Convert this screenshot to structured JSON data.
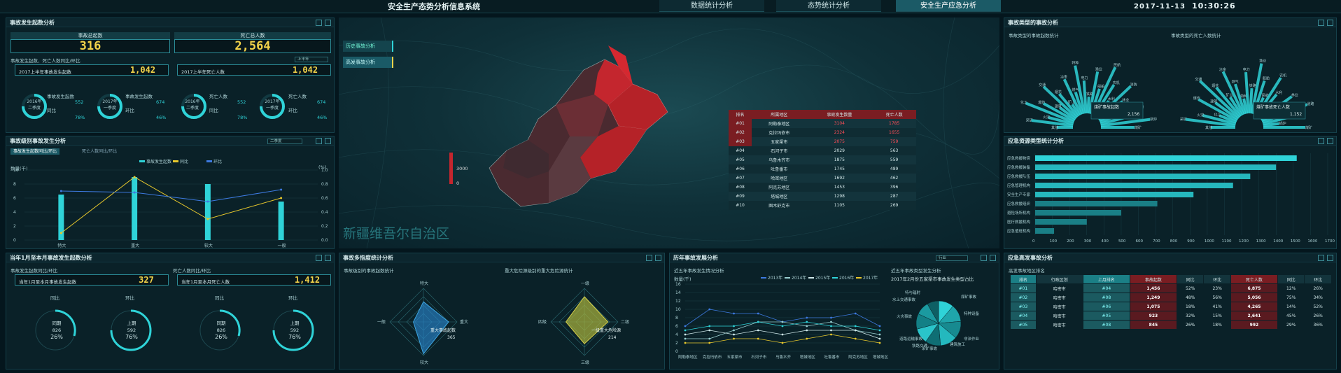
{
  "header": {
    "title": "安全生产态势分析信息系统",
    "nav": [
      "数据统计分析",
      "态势统计分析",
      "安全生产应急分析"
    ],
    "active": 2,
    "date": "2017-11-13",
    "time": "10:30:26"
  },
  "p1": {
    "title": "事故发生起数分析",
    "total_label": "事故总起数",
    "total": "316",
    "death_label": "死亡总人数",
    "death": "2,564",
    "sub": "事故发生起数、死亡人数同比/环比",
    "sel": "上半年",
    "left": {
      "label": "2017上半年事故发生起数",
      "value": "1,042",
      "g1": {
        "q": "2016年",
        "q2": "二季度",
        "a": "事故发生起数",
        "av": "552",
        "b": "同比",
        "bv": "78%"
      },
      "g2": {
        "q": "2017年",
        "q2": "一季度",
        "a": "事故发生起数",
        "av": "674",
        "b": "环比",
        "bv": "46%"
      }
    },
    "right": {
      "label": "2017上半年死亡人数",
      "value": "1,042",
      "g1": {
        "q": "2016年",
        "q2": "二季度",
        "a": "死亡人数",
        "av": "552",
        "b": "同比",
        "bv": "78%"
      },
      "g2": {
        "q": "2017年",
        "q2": "一季度",
        "a": "死亡人数",
        "av": "674",
        "b": "环比",
        "bv": "46%"
      }
    }
  },
  "p2": {
    "title": "事故级别事故发生分析",
    "sel": "二季度",
    "tabs": [
      "事故发生起数同比/环比",
      "死亡人数同比/环比"
    ],
    "legend": [
      "事故发生起数",
      "同比",
      "环比"
    ],
    "yl": "数量(千)",
    "yr": "(%)"
  },
  "p3": {
    "title": "当年1月至本月事故发生起数分析",
    "left": {
      "sub": "事故发生起数同比/环比",
      "label": "当年1月至本月事故发生起数",
      "value": "327"
    },
    "right": {
      "sub": "死亡人数同比/环比",
      "label": "当年1月至本月死亡人数",
      "value": "1,412"
    },
    "g": [
      {
        "h": "同比",
        "t": "同期",
        "v": "826",
        "p": "26%"
      },
      {
        "h": "环比",
        "t": "上期",
        "v": "592",
        "p": "76%"
      },
      {
        "h": "同比",
        "t": "同期",
        "v": "826",
        "p": "26%"
      },
      {
        "h": "环比",
        "t": "上期",
        "v": "592",
        "p": "76%"
      }
    ]
  },
  "map": {
    "tabs": [
      "历史事故分析",
      "高发事故分析"
    ],
    "region": "新疆维吾尔自治区",
    "scale_hi": "3000",
    "scale_lo": "0",
    "places": [
      "阿勒泰地区",
      "塔城地区",
      "克拉玛依市",
      "博尔塔拉蒙古自治州",
      "伊犁哈萨克自治州",
      "石河子市",
      "五家渠市",
      "昌吉回族自治州",
      "乌鲁木齐市",
      "吐鲁番市",
      "哈密地区",
      "阿克苏地区",
      "巴音郭楞蒙古自治州",
      "克孜勒苏柯尔克孜自治州",
      "喀什地区",
      "和田地区",
      "图木舒克市",
      "阿拉尔市"
    ],
    "table": {
      "headers": [
        "排名",
        "所属地区",
        "事故发生数量",
        "死亡人数"
      ],
      "rows": [
        [
          "#01",
          "阿勒泰地区",
          "3104",
          "1785"
        ],
        [
          "#02",
          "克拉玛依市",
          "2324",
          "1655"
        ],
        [
          "#03",
          "五家渠市",
          "2075",
          "759"
        ],
        [
          "#04",
          "石河子市",
          "2029",
          "563"
        ],
        [
          "#05",
          "乌鲁木齐市",
          "1875",
          "559"
        ],
        [
          "#06",
          "吐鲁番市",
          "1745",
          "489"
        ],
        [
          "#07",
          "哈密地区",
          "1692",
          "462"
        ],
        [
          "#08",
          "阿克苏地区",
          "1453",
          "396"
        ],
        [
          "#09",
          "塔城地区",
          "1298",
          "287"
        ],
        [
          "#10",
          "图木舒克市",
          "1105",
          "269"
        ]
      ]
    }
  },
  "p4": {
    "title": "事故多指度统计分析",
    "l": {
      "sub": "事故级别的事故起数统计",
      "axes": [
        "特大",
        "重大",
        "较大",
        "一般"
      ],
      "label": "重大事故起数",
      "val": "365"
    },
    "r": {
      "sub": "重大危险源级别的重大危险源统计",
      "axes": [
        "一级",
        "二级",
        "三级",
        "四级"
      ],
      "label": "一级重大危险源",
      "val": "214"
    }
  },
  "p5": {
    "title": "历年事故发展分析",
    "sel": "行业",
    "l": {
      "sub": "近五年事故发生情况分析",
      "yl": "数量(千)",
      "legend": [
        "2013年",
        "2014年",
        "2015年",
        "2016年",
        "2017年"
      ],
      "x": [
        "阿勒泰地区",
        "克拉玛依市",
        "五家渠市",
        "石河子市",
        "乌鲁木齐",
        "塔城地区",
        "吐鲁番市",
        "阿克苏地区",
        "塔城地区"
      ]
    },
    "r": {
      "sub": "近五年事故类型发生分析",
      "sub2": "2017年2月份五家渠市事故发生类型占比",
      "labels": [
        "特与辐射",
        "水上交通事故",
        "煤矿事故",
        "火灾事故",
        "特种设备",
        "道路运输事故",
        "非法作业",
        "铁路交通",
        "建筑施工",
        "采矿事故"
      ]
    }
  },
  "p6": {
    "title": "事故类型的事故分析",
    "l": {
      "sub": "事故类型的事故起数统计",
      "tip": "煤矿事故起数",
      "tipv": "2,156"
    },
    "r": {
      "sub": "事故类型的死亡人数统计",
      "tip": "煤矿事故死亡人数",
      "tipv": "1,152"
    },
    "cats": [
      "其他",
      "采矿",
      "火灾",
      "化工",
      "爆炸",
      "建筑",
      "交通",
      "烟花",
      "矿山",
      "冶金",
      "燃气",
      "特种",
      "电力",
      "铁路",
      "渔业",
      "船舶",
      "民航",
      "农机",
      "水利",
      "消防",
      "林业",
      "危化",
      "道路",
      "机械",
      "锅炉",
      "煤矿"
    ]
  },
  "p7": {
    "title": "应急资源类型统计分析",
    "items": [
      "应急救援物资",
      "应急救援装备",
      "应急救援队伍",
      "应急管理机构",
      "安全生产专家",
      "应急救援组织",
      "避险场所机构",
      "医疗救援机构",
      "应急值班机构"
    ],
    "values": [
      1520,
      1400,
      1250,
      1150,
      920,
      710,
      500,
      300,
      110
    ],
    "ticks": [
      "0",
      "100",
      "200",
      "300",
      "400",
      "500",
      "600",
      "700",
      "800",
      "900",
      "1000",
      "1100",
      "1200",
      "1300",
      "1400",
      "1500",
      "1600",
      "1700"
    ]
  },
  "p8": {
    "title": "应急高发事故分析",
    "sub": "高发事故地区排名",
    "headers": [
      "排名",
      "行政区划",
      "上月排名",
      "事故起数",
      "同比",
      "环比",
      "死亡人数",
      "同比",
      "环比"
    ],
    "rows": [
      [
        "#01",
        "哈密市",
        "#04",
        "1,456",
        "52%",
        "23%",
        "6,875",
        "12%",
        "26%"
      ],
      [
        "#02",
        "哈密市",
        "#08",
        "1,249",
        "48%",
        "56%",
        "5,056",
        "75%",
        "34%"
      ],
      [
        "#03",
        "哈密市",
        "#06",
        "1,075",
        "18%",
        "41%",
        "4,265",
        "14%",
        "52%"
      ],
      [
        "#04",
        "哈密市",
        "#05",
        "923",
        "32%",
        "15%",
        "2,641",
        "45%",
        "26%"
      ],
      [
        "#05",
        "哈密市",
        "#08",
        "845",
        "26%",
        "18%",
        "992",
        "29%",
        "36%"
      ]
    ]
  },
  "colors": {
    "accent": "#2fd3d8",
    "yellow": "#f3d34a",
    "red": "#c4262e",
    "dark": "#04161d"
  },
  "chart_data": [
    {
      "type": "bar",
      "title": "事故级别事故发生分析",
      "categories": [
        "特大",
        "重大",
        "较大",
        "一般"
      ],
      "series": [
        {
          "name": "事故发生起数",
          "values": [
            6.5,
            9,
            8,
            5.5
          ]
        },
        {
          "name": "同比",
          "values": [
            0.1,
            0.9,
            0.3,
            0.6
          ]
        },
        {
          "name": "环比",
          "values": [
            0.7,
            0.68,
            0.55,
            0.72
          ]
        }
      ],
      "ylim": [
        0,
        10
      ],
      "y2lim": [
        0,
        1
      ]
    },
    {
      "type": "line",
      "title": "近五年事故发生情况分析",
      "categories": [
        "阿勒泰地区",
        "克拉玛依市",
        "五家渠市",
        "石河子市",
        "乌鲁木齐",
        "塔城地区",
        "吐鲁番市",
        "阿克苏地区",
        "塔城地区"
      ],
      "series": [
        {
          "name": "2013年",
          "values": [
            6,
            10,
            9,
            9,
            7,
            8,
            8,
            9,
            6
          ]
        },
        {
          "name": "2014年",
          "values": [
            3,
            3,
            5,
            7,
            7,
            6,
            7,
            5,
            4
          ]
        },
        {
          "name": "2015年",
          "values": [
            4,
            5,
            4,
            5,
            4,
            5,
            5,
            5,
            3
          ]
        },
        {
          "name": "2016年",
          "values": [
            5,
            6,
            6,
            7,
            6,
            7,
            6,
            6,
            5
          ]
        },
        {
          "name": "2017年",
          "values": [
            2,
            2,
            3,
            3,
            2,
            3,
            4,
            3,
            2
          ]
        }
      ],
      "ylim": [
        0,
        16
      ]
    },
    {
      "type": "bar",
      "title": "应急资源类型统计分析",
      "categories": [
        "应急救援物资",
        "应急救援装备",
        "应急救援队伍",
        "应急管理机构",
        "安全生产专家",
        "应急救援组织",
        "避险场所机构",
        "医疗救援机构",
        "应急值班机构"
      ],
      "values": [
        1520,
        1400,
        1250,
        1150,
        920,
        710,
        500,
        300,
        110
      ],
      "xlim": [
        0,
        1700
      ]
    }
  ]
}
